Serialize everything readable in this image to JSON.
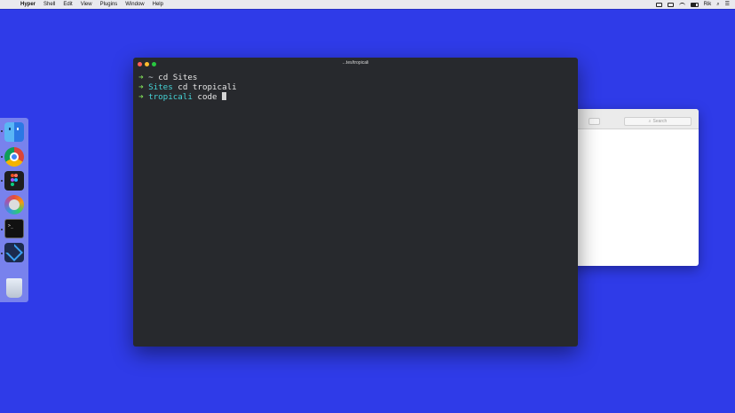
{
  "menubar": {
    "app_name": "Hyper",
    "menus": [
      "Shell",
      "Edit",
      "View",
      "Plugins",
      "Window",
      "Help"
    ],
    "user": "Rik"
  },
  "terminal": {
    "title": "...tes/tropicali",
    "lines": [
      {
        "arrow": "➜",
        "cwd": " ~",
        "cmd": " cd Sites"
      },
      {
        "arrow": "➜",
        "cwd": " Sites",
        "cmd": " cd tropicali"
      },
      {
        "arrow": "➜",
        "cwd": " tropicali",
        "cmd": " code "
      }
    ]
  },
  "background_window": {
    "search_placeholder": "Search"
  },
  "dock": {
    "items": [
      "finder-icon",
      "chrome-icon",
      "figma-icon",
      "dvd-player-icon",
      "terminal-icon",
      "vscode-icon",
      "trash-icon"
    ]
  },
  "colors": {
    "desktop": "#2f3be8",
    "terminal_bg": "#27292d",
    "prompt_arrow": "#7ed957",
    "cwd": "#45d3d6",
    "traffic_close": "#ff5f57",
    "traffic_min": "#febc2e",
    "traffic_max": "#28c840"
  }
}
